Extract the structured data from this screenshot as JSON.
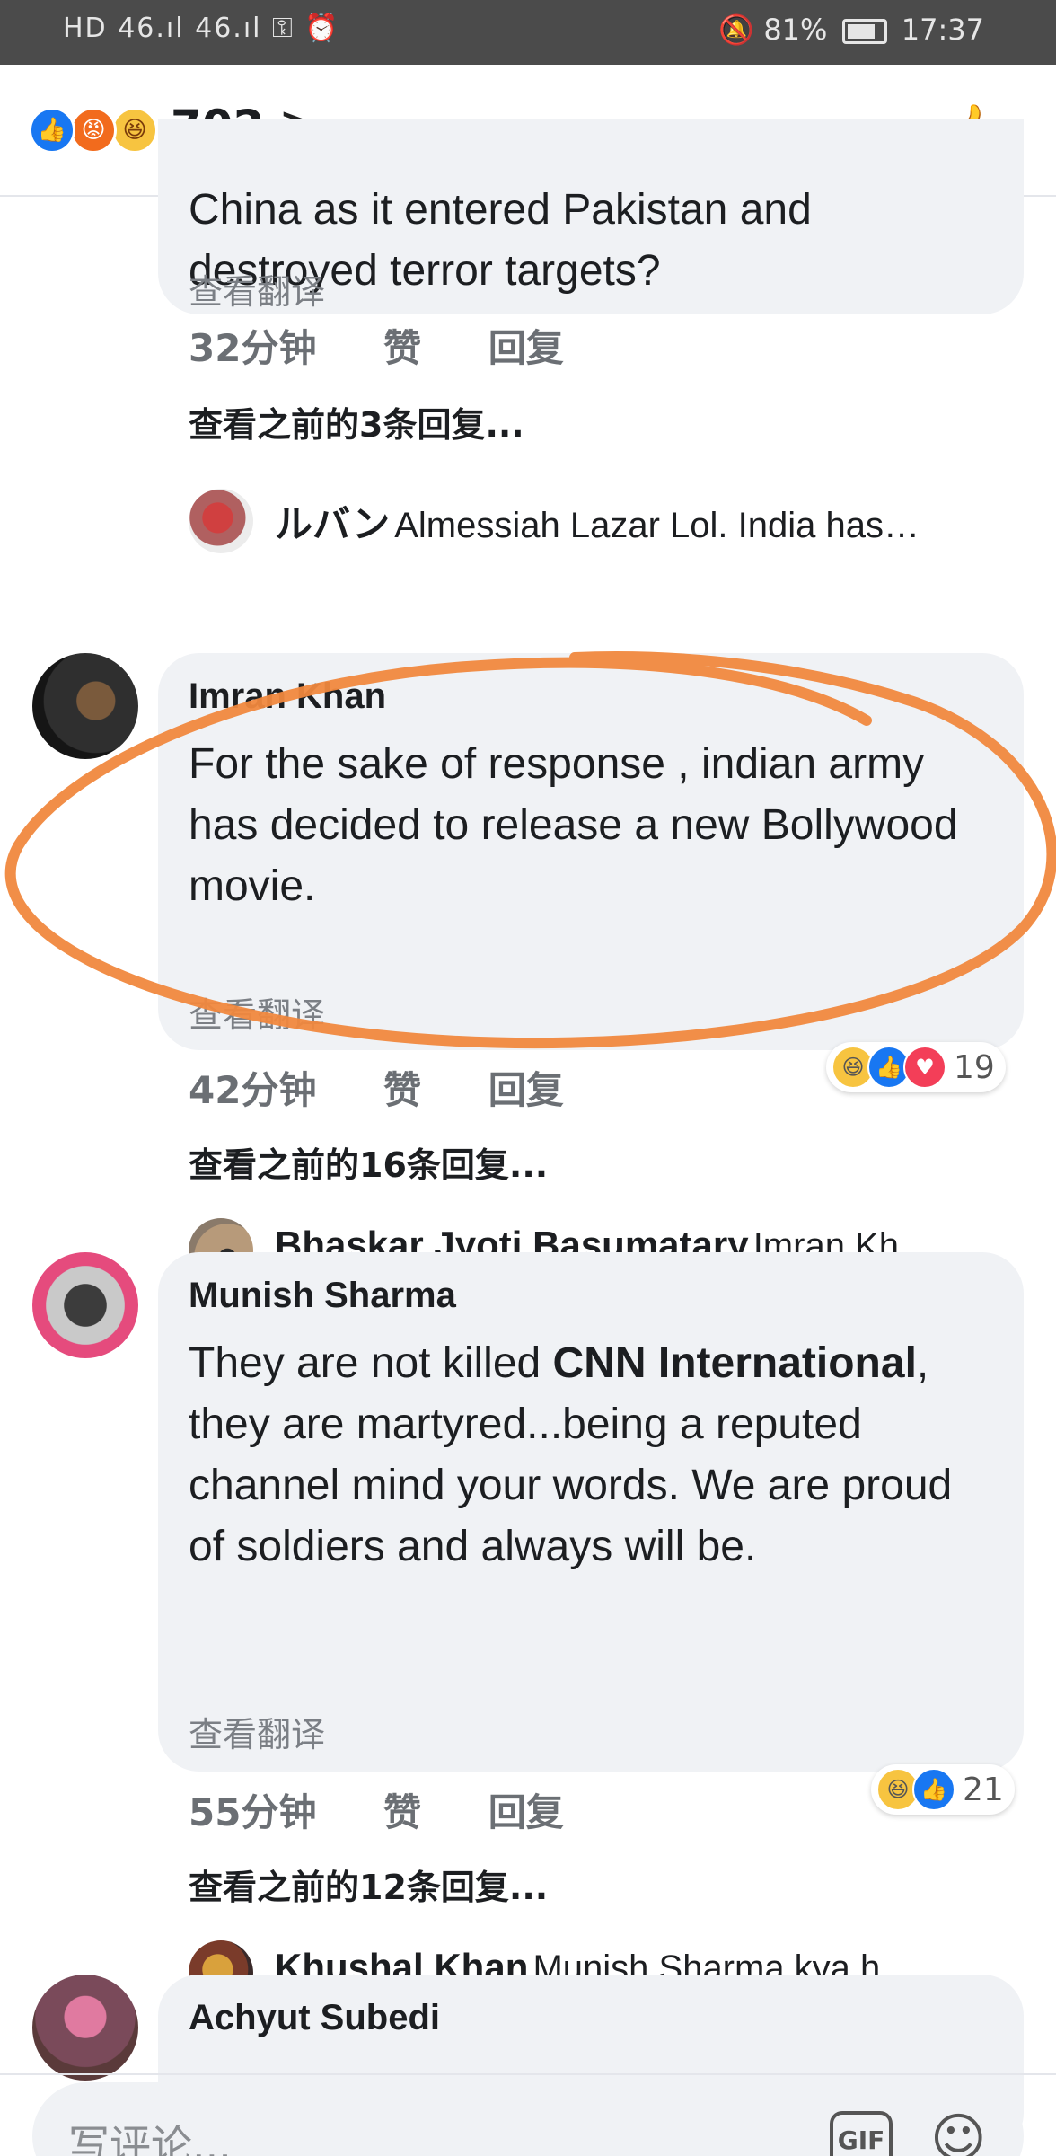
{
  "status_bar": {
    "left": "HD  46.ıl  46.ıl  ⚿ ⏰",
    "battery_percent": "81%",
    "time": "17:37"
  },
  "header": {
    "reaction_count": "702",
    "reactions": [
      "like-icon",
      "angry-icon",
      "haha-icon"
    ]
  },
  "comments": [
    {
      "text": "China as it entered Pakistan and destroyed terror targets?",
      "translate": "查看翻译",
      "time": "32分钟",
      "like": "赞",
      "reply": "回复",
      "view_previous": "查看之前的3条回复...",
      "reply_preview": {
        "name": "ルバン",
        "text": "Almessiah Lazar Lol. India has…"
      }
    },
    {
      "author": "Imran Khan",
      "text": "For the sake of response , indian army has decided to release a new Bollywood movie.",
      "translate": "查看翻译",
      "time": "42分钟",
      "like": "赞",
      "reply": "回复",
      "reaction_count": "19",
      "view_previous": "查看之前的16条回复...",
      "reply_preview": {
        "name": "Bhaskar Jyoti Basumatary",
        "text": "Imran Kh…"
      }
    },
    {
      "author": "Munish Sharma",
      "text_parts": [
        "They are not killed ",
        "CNN International",
        ", they are martyred...being a reputed channel mind your words. We are proud of soldiers and always will be."
      ],
      "translate": "查看翻译",
      "time": "55分钟",
      "like": "赞",
      "reply": "回复",
      "reaction_count": "21",
      "view_previous": "查看之前的12条回复...",
      "reply_preview": {
        "name": "Khushal Khan",
        "text": "Munish Sharma kya h…"
      }
    },
    {
      "author": "Achyut Subedi"
    }
  ],
  "composer": {
    "placeholder": "写评论...",
    "gif": "GIF"
  },
  "colors": {
    "like": "#1877f2",
    "love": "#f33e58",
    "haha": "#f7c440",
    "angry": "#f26b1d",
    "annotation": "#f0883e",
    "bubble": "#f0f2f5"
  }
}
